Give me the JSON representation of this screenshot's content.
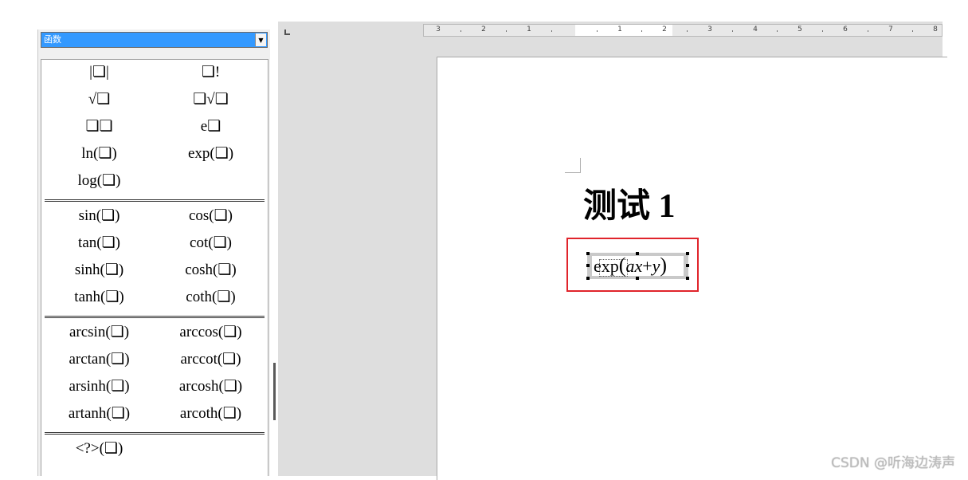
{
  "function_panel": {
    "category": "函数",
    "groups": [
      {
        "items": [
          [
            "|❏|",
            "❏!"
          ],
          [
            "√❏",
            "❏√❏"
          ],
          [
            "❏❏",
            "e❏"
          ],
          [
            "ln(❏)",
            "exp(❏)"
          ],
          [
            "log(❏)",
            ""
          ]
        ]
      },
      {
        "items": [
          [
            "sin(❏)",
            "cos(❏)"
          ],
          [
            "tan(❏)",
            "cot(❏)"
          ],
          [
            "sinh(❏)",
            "cosh(❏)"
          ],
          [
            "tanh(❏)",
            "coth(❏)"
          ]
        ]
      },
      {
        "items": [
          [
            "arcsin(❏)",
            "arccos(❏)"
          ],
          [
            "arctan(❏)",
            "arccot(❏)"
          ],
          [
            "arsinh(❏)",
            "arcosh(❏)"
          ],
          [
            "artanh(❏)",
            "arcoth(❏)"
          ]
        ]
      },
      {
        "items": [
          [
            "<?>(❏)",
            ""
          ]
        ]
      }
    ]
  },
  "ruler": {
    "labels": [
      "3",
      "2",
      "1",
      "1",
      "2",
      "3",
      "4",
      "5",
      "6",
      "7",
      "8"
    ]
  },
  "document": {
    "heading": "测试 1",
    "formula": {
      "func": "exp",
      "open": "(",
      "a": "a",
      "x": "x",
      "op": "+",
      "y": "y",
      "close": ")"
    }
  },
  "colors": {
    "highlight": "#e0242b",
    "selection": "#3399ff"
  },
  "watermark": "CSDN @听海边涛声"
}
